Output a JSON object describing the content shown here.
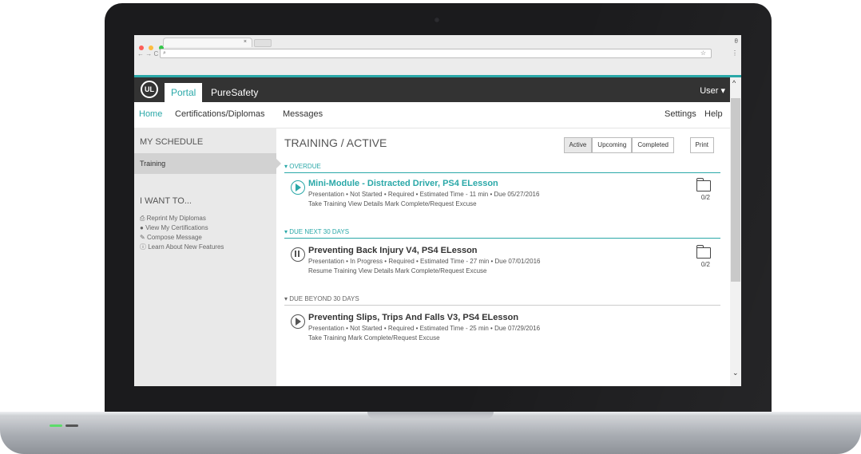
{
  "browser": {
    "tab_close": "×",
    "nav": "← → C",
    "omnibox_icon": "search-icon",
    "star": "☆",
    "menu": "⋮",
    "account": "θ"
  },
  "app": {
    "logo": "UL",
    "portal": "Portal",
    "brand": "PureSafety",
    "user": "User ▾",
    "accent": "#2aa8a8"
  },
  "subnav": {
    "home": "Home",
    "certs": "Certifications/Diplomas",
    "messages": "Messages",
    "settings": "Settings",
    "help": "Help"
  },
  "sidebar": {
    "title": "MY SCHEDULE",
    "training": "Training",
    "want": "I WANT TO...",
    "links": [
      "Reprint My Diplomas",
      "View My Certifications",
      "Compose Message",
      "Learn About New Features"
    ]
  },
  "main": {
    "title": "TRAINING / ACTIVE",
    "tabs": [
      "Active",
      "Upcoming",
      "Completed"
    ],
    "print": "Print",
    "sections": {
      "overdue": "▾ OVERDUE",
      "next30": "▾ DUE NEXT 30 DAYS",
      "beyond30": "▾ DUE BEYOND 30 DAYS"
    },
    "items": [
      {
        "title": "Mini-Module - Distracted Driver, PS4 ELesson",
        "meta": "Presentation  •  Not Started  •  Required  •  Estimated Time - 11 min  •  Due 05/27/2016",
        "actions": "Take Training   View Details   Mark Complete/Request Excuse",
        "count": "0/2"
      },
      {
        "title": "Preventing Back Injury V4, PS4 ELesson",
        "meta": "Presentation  •  In Progress  •  Required  •  Estimated Time - 27 min  •  Due 07/01/2016",
        "actions": "Resume Training   View Details   Mark Complete/Request Excuse",
        "count": "0/2"
      },
      {
        "title": "Preventing Slips, Trips And Falls V3, PS4 ELesson",
        "meta": "Presentation  •  Not Started  •  Required  •  Estimated Time - 25 min  •  Due 07/29/2016",
        "actions": "Take Training   Mark Complete/Request Excuse"
      }
    ]
  },
  "scrollbar": {
    "up": "^",
    "down": "⌄"
  }
}
